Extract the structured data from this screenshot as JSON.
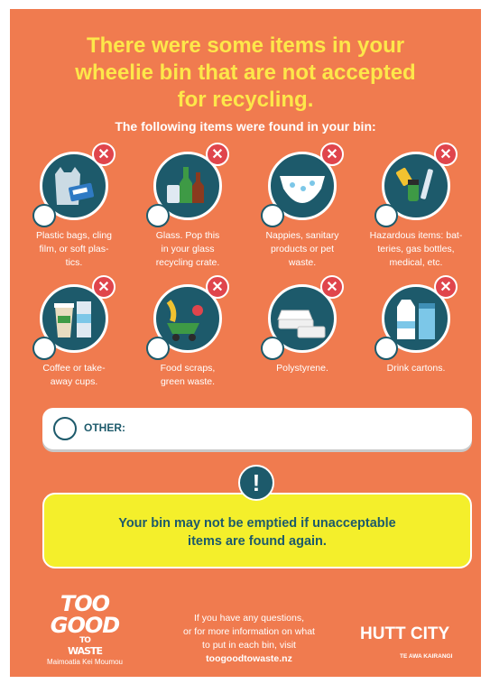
{
  "headline": [
    "There were some items in your",
    "wheelie bin that are not accepted",
    "for recycling."
  ],
  "subhead": "The following items were found in your bin:",
  "items": [
    {
      "icon": "plastic-bags-icon",
      "caption": [
        "Plastic bags, cling",
        "film, or soft plas-",
        "tics."
      ]
    },
    {
      "icon": "glass-bottles-icon",
      "caption": [
        "Glass. Pop this",
        "in your glass",
        "recycling crate."
      ]
    },
    {
      "icon": "nappies-icon",
      "caption": [
        "Nappies, sanitary",
        "products or pet",
        "waste."
      ]
    },
    {
      "icon": "hazardous-items-icon",
      "caption": [
        "Hazardous items: bat-",
        "teries, gas bottles,",
        "medical, etc."
      ]
    },
    {
      "icon": "coffee-cups-icon",
      "caption": [
        "Coffee or take-",
        "away cups."
      ]
    },
    {
      "icon": "food-scraps-icon",
      "caption": [
        "Food scraps,",
        "green waste."
      ]
    },
    {
      "icon": "polystyrene-icon",
      "caption": [
        "Polystyrene."
      ]
    },
    {
      "icon": "drink-cartons-icon",
      "caption": [
        "Drink cartons."
      ]
    }
  ],
  "other_label": "OTHER:",
  "warning_icon": "!",
  "warning": [
    "Your bin may not be emptied if unacceptable",
    "items are found again."
  ],
  "logo_left": {
    "line1": "TOO",
    "line2": "GOOD",
    "line3": "TO",
    "line4": "WASTE",
    "tagline": "Maimoatia Kei Moumou"
  },
  "contact": [
    "If you have any questions,",
    "or for more information on what",
    "to put in each bin, visit"
  ],
  "url": "toogoodtowaste.nz",
  "logo_right": {
    "name": "HUTT CITY",
    "sub": "TE AWA KAIRANGI"
  },
  "colors": {
    "background": "#f07b4f",
    "headline": "#fde74a",
    "circle": "#1d5a6b",
    "badge": "#e0454c",
    "warning_bg": "#f4ef2b"
  }
}
